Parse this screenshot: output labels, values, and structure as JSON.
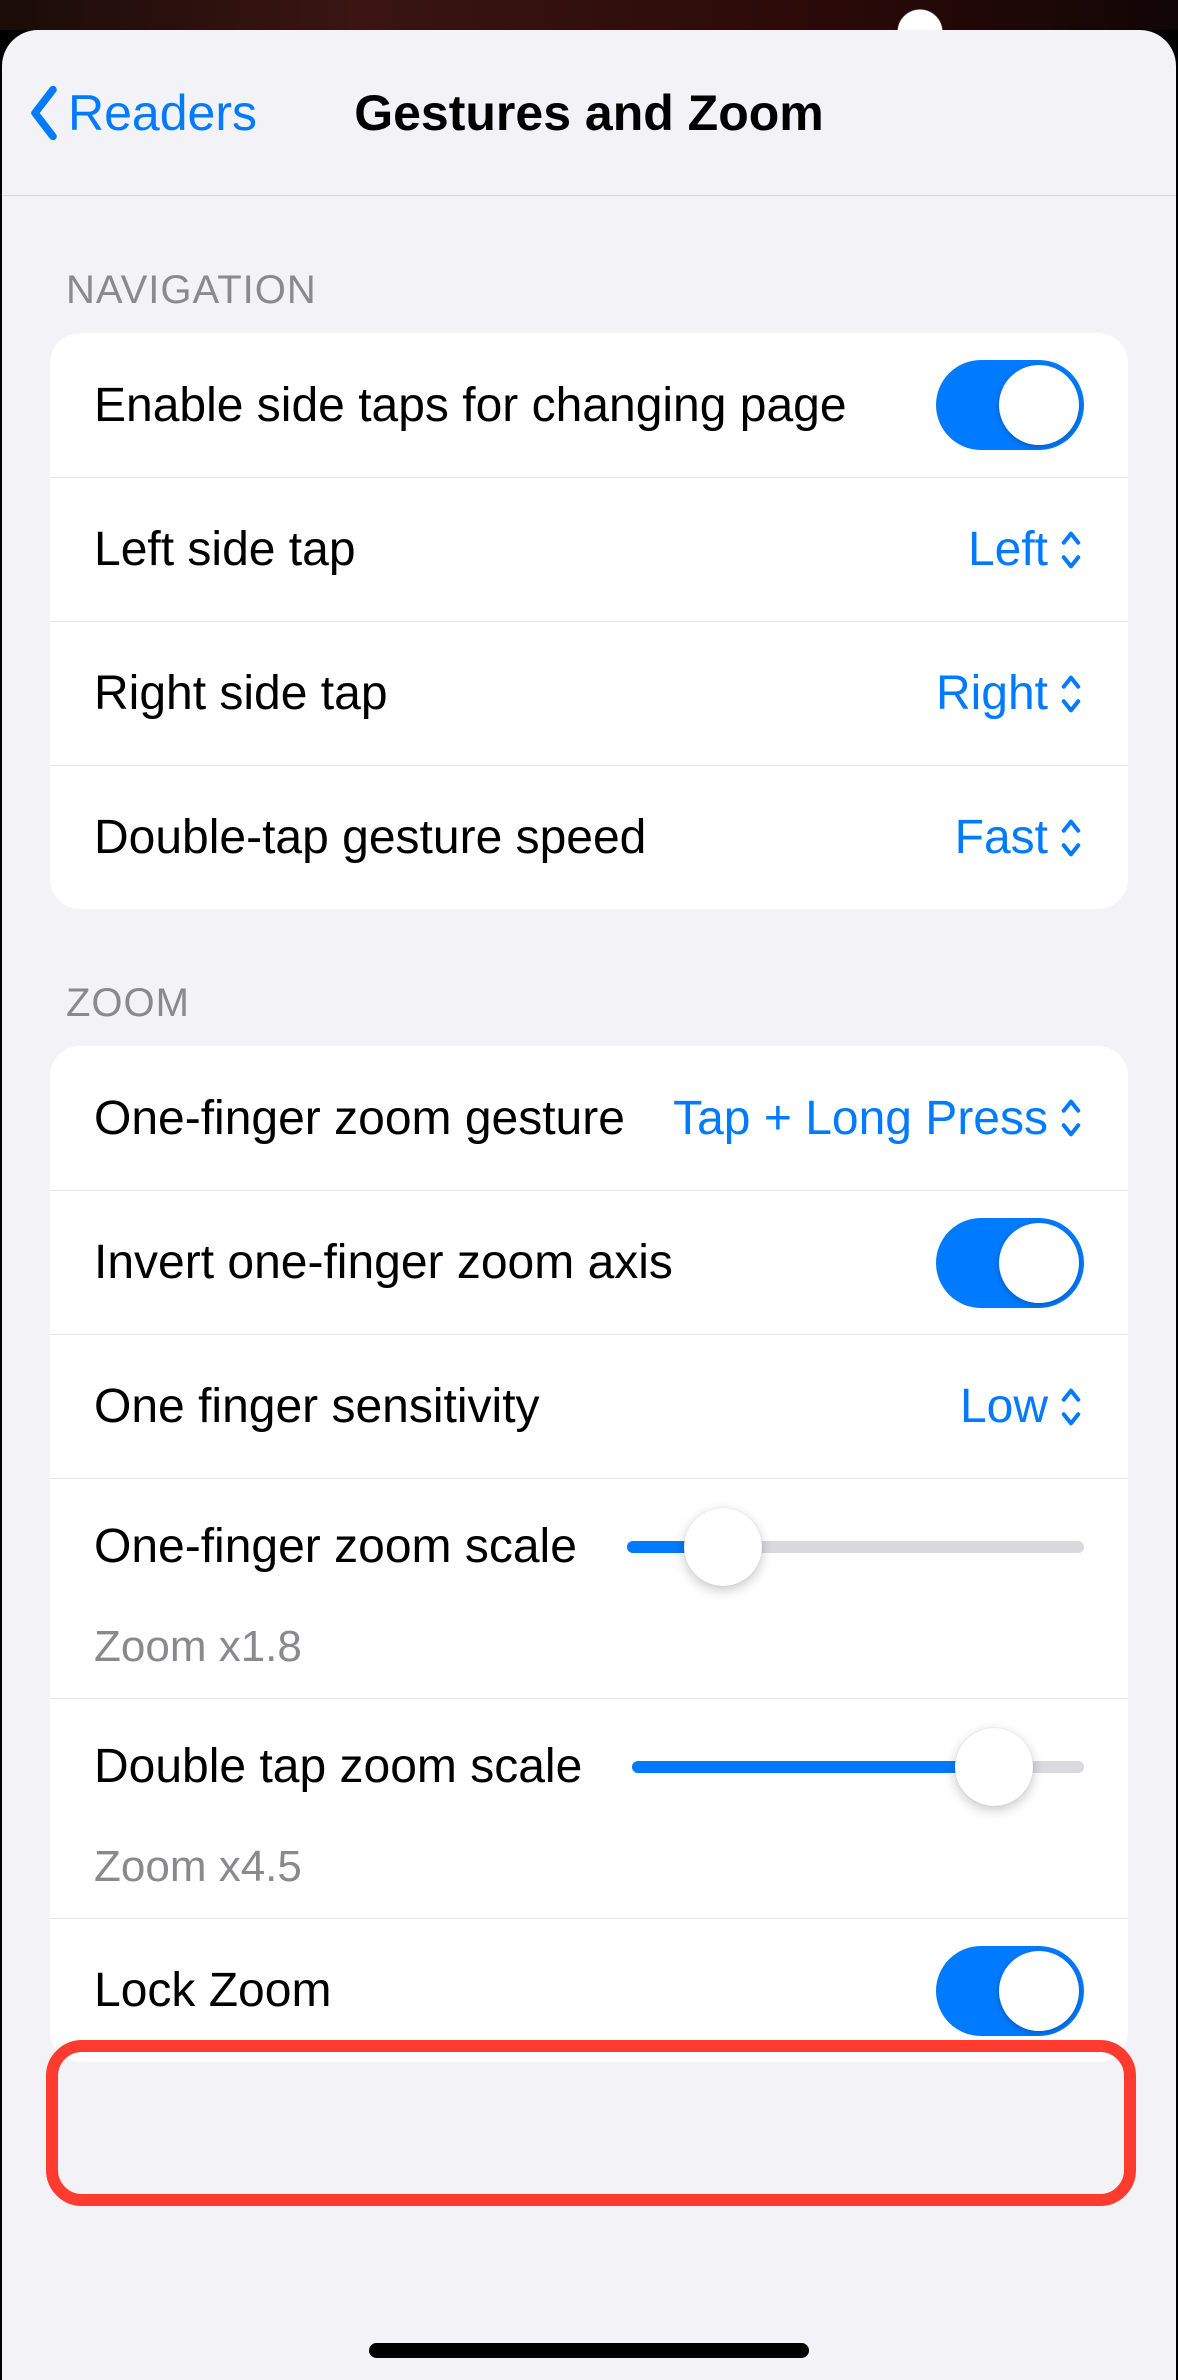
{
  "nav": {
    "back_label": "Readers",
    "title": "Gestures and Zoom"
  },
  "sections": {
    "navigation": {
      "header": "NAVIGATION",
      "enable_side_taps": {
        "label": "Enable side taps for changing page",
        "on": true
      },
      "left_side_tap": {
        "label": "Left side tap",
        "value": "Left"
      },
      "right_side_tap": {
        "label": "Right side tap",
        "value": "Right"
      },
      "double_tap_speed": {
        "label": "Double-tap gesture speed",
        "value": "Fast"
      }
    },
    "zoom": {
      "header": "ZOOM",
      "one_finger_gesture": {
        "label": "One-finger zoom gesture",
        "value": "Tap + Long Press"
      },
      "invert_axis": {
        "label": "Invert one-finger zoom axis",
        "on": true
      },
      "sensitivity": {
        "label": "One finger sensitivity",
        "value": "Low"
      },
      "one_finger_scale": {
        "label": "One-finger zoom scale",
        "sub": "Zoom x1.8",
        "percent": 21
      },
      "double_tap_scale": {
        "label": "Double tap zoom scale",
        "sub": "Zoom x4.5",
        "percent": 80
      },
      "lock_zoom": {
        "label": "Lock Zoom",
        "on": true
      }
    }
  }
}
